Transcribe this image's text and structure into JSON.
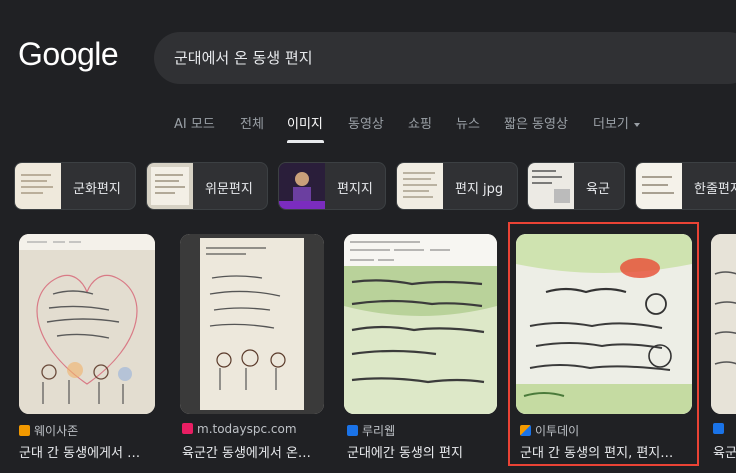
{
  "logo": "Google",
  "search": {
    "query": "군대에서 온 동생 편지"
  },
  "tabs": [
    {
      "label": "AI 모드"
    },
    {
      "label": "전체"
    },
    {
      "label": "이미지",
      "active": true
    },
    {
      "label": "동영상"
    },
    {
      "label": "쇼핑"
    },
    {
      "label": "뉴스"
    },
    {
      "label": "짧은 동영상"
    },
    {
      "label": "더보기"
    }
  ],
  "chips": [
    {
      "label": "군화편지"
    },
    {
      "label": "위문편지"
    },
    {
      "label": "편지지"
    },
    {
      "label": "편지 jpg"
    },
    {
      "label": "육군"
    },
    {
      "label": "한줄편지"
    }
  ],
  "results": [
    {
      "source": "웨이사존",
      "title": "군대 간 동생에게서 …",
      "source_color": "#f29900"
    },
    {
      "source": "m.todayspc.com",
      "title": "육군간 동생에게서 온…",
      "source_color": "#e91e63"
    },
    {
      "source": "루리웹",
      "title": "군대에간 동생의 편지",
      "source_color": "#1a73e8"
    },
    {
      "source": "이투데이",
      "title": "군대 간 동생의 편지, 편지…",
      "source_color": "#1a73e8"
    },
    {
      "source": "",
      "title": "육군",
      "source_color": "#1a73e8"
    }
  ],
  "colors": {
    "background": "#202124",
    "highlight": "#ea4335",
    "search_bg": "#303134"
  }
}
